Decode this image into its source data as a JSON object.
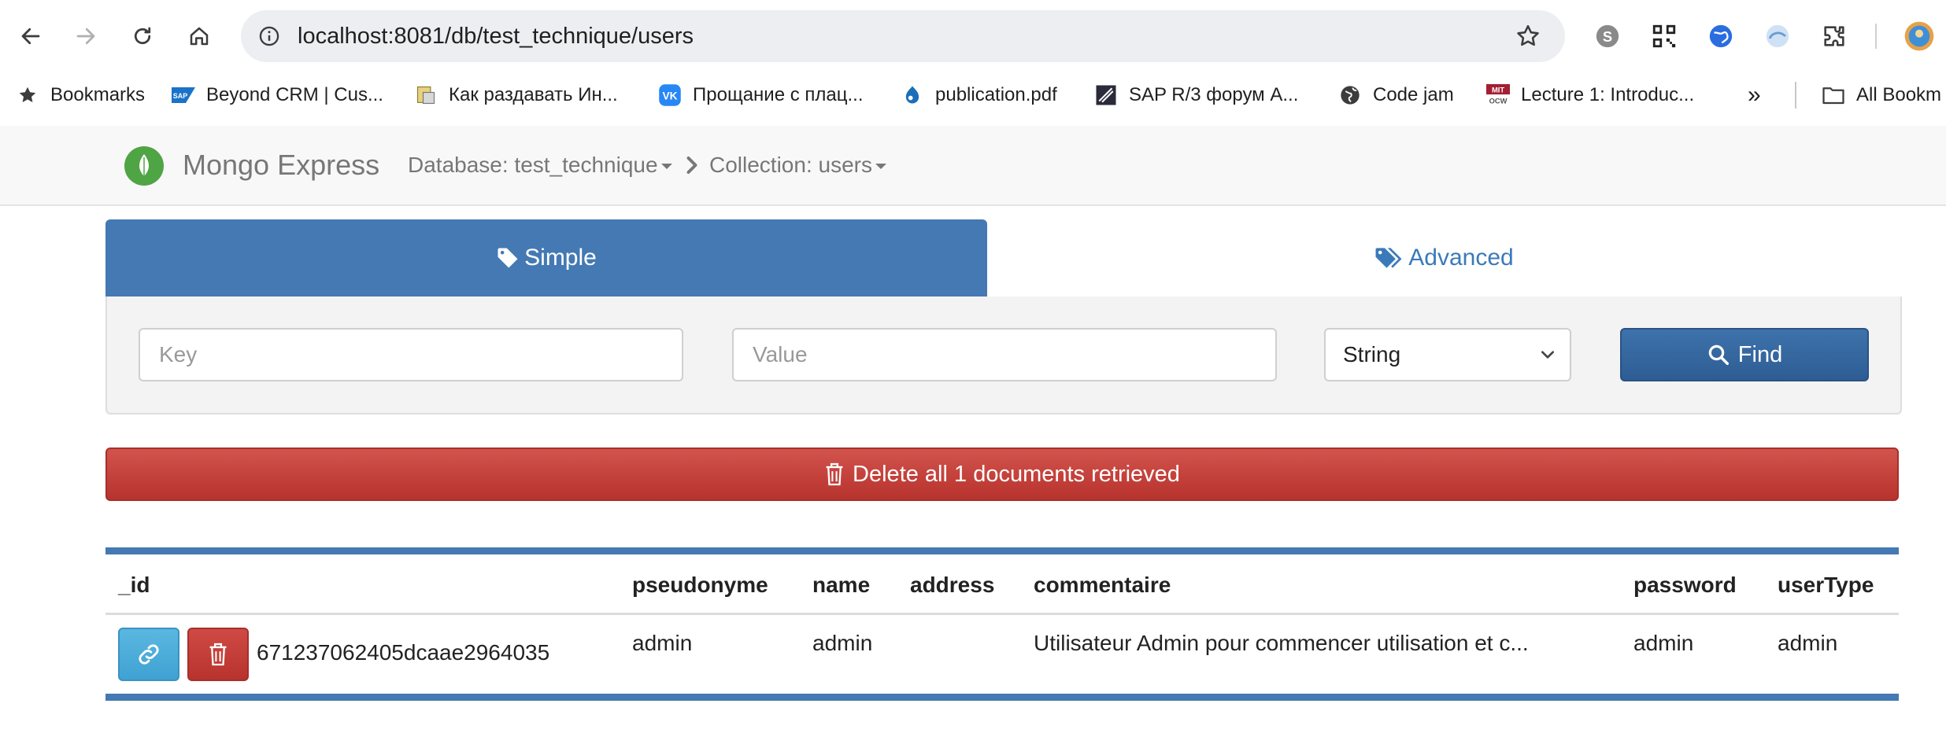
{
  "browser": {
    "url": "localhost:8081/db/test_technique/users",
    "bookmarks": [
      {
        "label": "Bookmarks",
        "icon": "star-icon"
      },
      {
        "label": "Beyond CRM | Cus...",
        "icon": "sap-icon"
      },
      {
        "label": "Как раздавать Ин...",
        "icon": "page-icon"
      },
      {
        "label": "Прощание с плац...",
        "icon": "vk-icon"
      },
      {
        "label": "publication.pdf",
        "icon": "drupal-icon"
      },
      {
        "label": "SAP R/3 форум A...",
        "icon": "forum-icon"
      },
      {
        "label": "Code jam",
        "icon": "globe-icon"
      },
      {
        "label": "Lecture 1: Introduc...",
        "icon": "mit-icon"
      }
    ],
    "more_label": "»",
    "all_bookmarks_label": "All Bookm"
  },
  "app": {
    "brand": "Mongo Express",
    "database_label": "Database: test_technique",
    "collection_label": "Collection: users"
  },
  "search": {
    "tab_simple": "Simple",
    "tab_advanced": "Advanced",
    "key_placeholder": "Key",
    "value_placeholder": "Value",
    "type_selected": "String",
    "find_label": "Find"
  },
  "delete_all_label": "Delete all 1 documents retrieved",
  "table": {
    "columns": [
      "_id",
      "pseudonyme",
      "name",
      "address",
      "commentaire",
      "password",
      "userType"
    ],
    "rows": [
      {
        "_id": "671237062405dcaae2964035",
        "pseudonyme": "admin",
        "name": "admin",
        "address": "",
        "commentaire": "Utilisateur Admin pour commencer utilisation et c...",
        "password": "admin",
        "userType": "admin"
      }
    ]
  },
  "colors": {
    "primary": "#4479b3",
    "danger": "#b8332d",
    "info": "#5bb7e0"
  }
}
